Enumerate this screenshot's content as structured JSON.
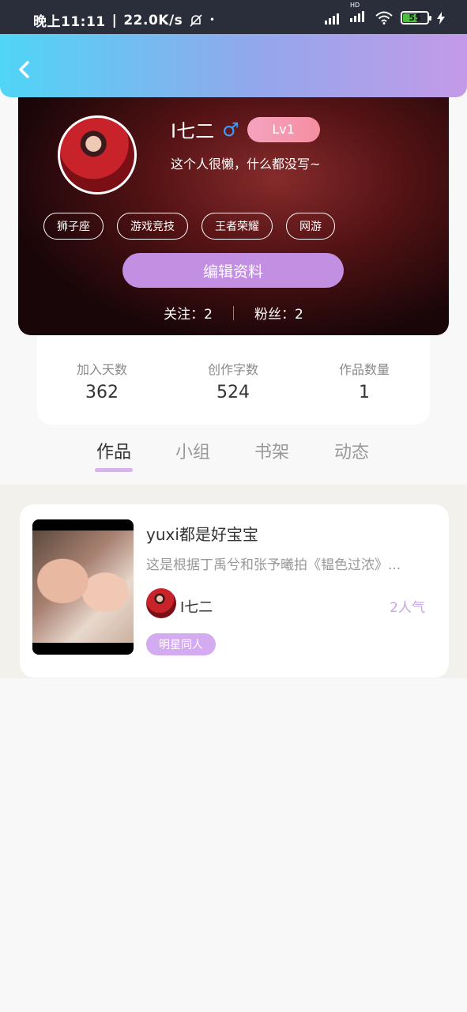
{
  "status_bar": {
    "time": "晚上11:11",
    "network_speed": "22.0K/s",
    "battery_level": "55",
    "signal_label": "HD"
  },
  "header": {
    "back_icon": "chevron-left-icon"
  },
  "profile": {
    "username": "I七二",
    "gender_symbol": "♂",
    "level": "Lv1",
    "bio": "这个人很懒，什么都没写~",
    "tags": [
      "狮子座",
      "游戏竞技",
      "王者荣耀",
      "网游"
    ],
    "edit_button": "编辑资料",
    "following_label": "关注：2",
    "followers_label": "粉丝：2"
  },
  "stats": [
    {
      "label": "加入天数",
      "value": "362"
    },
    {
      "label": "创作字数",
      "value": "524"
    },
    {
      "label": "作品数量",
      "value": "1"
    }
  ],
  "tabs": [
    {
      "label": "作品",
      "active": true
    },
    {
      "label": "小组",
      "active": false
    },
    {
      "label": "书架",
      "active": false
    },
    {
      "label": "动态",
      "active": false
    }
  ],
  "works": [
    {
      "title": "yuxi都是好宝宝",
      "description": "这是根据丁禹兮和张予曦拍《韫色过浓》...",
      "author": "I七二",
      "popularity": "2人气",
      "category": "明星同人"
    }
  ],
  "colors": {
    "header_gradient_start": "#4fd5f7",
    "header_gradient_end": "#c39ae8",
    "accent_purple": "#c38fe3",
    "level_pink": "#f58ea0",
    "gender_blue": "#3da0ff"
  }
}
